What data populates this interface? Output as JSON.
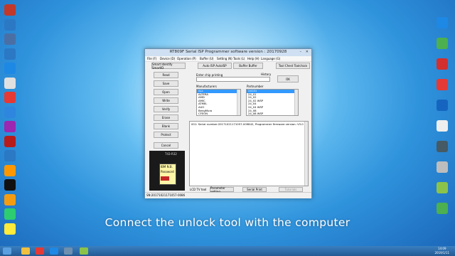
{
  "desktop_left_icons": [
    {
      "label": "",
      "color": "#c0392b"
    },
    {
      "label": "",
      "color": "#2b78c5"
    },
    {
      "label": "",
      "color": "#4a6fa5"
    },
    {
      "label": "",
      "color": "#2b78c5"
    },
    {
      "label": "",
      "color": "#1e88e5"
    },
    {
      "label": "",
      "color": "#e0e0e0"
    },
    {
      "label": "",
      "color": "#e53935"
    },
    {
      "label": "",
      "color": "#2e86de"
    },
    {
      "label": "",
      "color": "#9c27b0"
    },
    {
      "label": "",
      "color": "#b71c1c"
    },
    {
      "label": "",
      "color": "#2b78c5"
    },
    {
      "label": "",
      "color": "#ff9800"
    },
    {
      "label": "",
      "color": "#111111"
    },
    {
      "label": "",
      "color": "#f39c12"
    },
    {
      "label": "",
      "color": "#2ecc71"
    },
    {
      "label": "",
      "color": "#ffeb3b"
    }
  ],
  "desktop_right_icons": [
    {
      "label": "",
      "color": "#1e88e5"
    },
    {
      "label": "",
      "color": "#4caf50"
    },
    {
      "label": "",
      "color": "#d32f2f"
    },
    {
      "label": "",
      "color": "#e53935"
    },
    {
      "label": "",
      "color": "#1565c0"
    },
    {
      "label": "",
      "color": "#eeeeee"
    },
    {
      "label": "",
      "color": "#455a64"
    },
    {
      "label": "",
      "color": "#bdbdbd"
    },
    {
      "label": "",
      "color": "#8bc34a"
    },
    {
      "label": "",
      "color": "#4caf50"
    }
  ],
  "window": {
    "title": "RT809F Serial ISP Programmer software version : 20170928",
    "menu": [
      "File (F)",
      "Device (D)",
      "Operation (P)",
      "Buffer (U)",
      "Setting (N)",
      "Tools (L)",
      "Help (H)",
      "Language (G)"
    ],
    "top_buttons": [
      "Smart Identify SmartID",
      "Auto ISP AutoISP",
      "Buffer Buffer",
      "Tool Chest Toolchain"
    ],
    "side_buttons": [
      "Read",
      "Save",
      "Open",
      "Write",
      "Verify",
      "Erase",
      "Blank",
      "Protect",
      "Cancel"
    ],
    "chip_label": "Enter chip printing",
    "history_label": "History",
    "ok_label": "OK",
    "manufacturer_label": "Manufacturers",
    "partnumber_label": "Partnumber",
    "manufacturers": [
      "ALL",
      "ALTERA",
      "AMD",
      "AMIC",
      "ATMEL",
      "AUO",
      "BengMuro",
      "CFEON"
    ],
    "partnumbers": [
      "24C01",
      "24_01",
      "24_02",
      "24_02 WSP",
      "24_04",
      "24_04 WSP",
      "24_08",
      "24_08 WSP"
    ],
    "log_line": "001: Serial number:20171021171057-009842, Programmer firmware version: V3.0 ...",
    "bottom_buttons": [
      "Parameter setting",
      "Serial Print",
      "Tutorials"
    ],
    "lcd_label": "LCD TV tool",
    "status": "SN:20171021171057-0086",
    "chip_image_text": [
      "T43-R32",
      "IBM N.B.",
      "Password"
    ]
  },
  "caption": "Connect the unlock tool with the computer",
  "taskbar": {
    "clock_time": "14:09",
    "clock_date": "2019/1/11"
  }
}
